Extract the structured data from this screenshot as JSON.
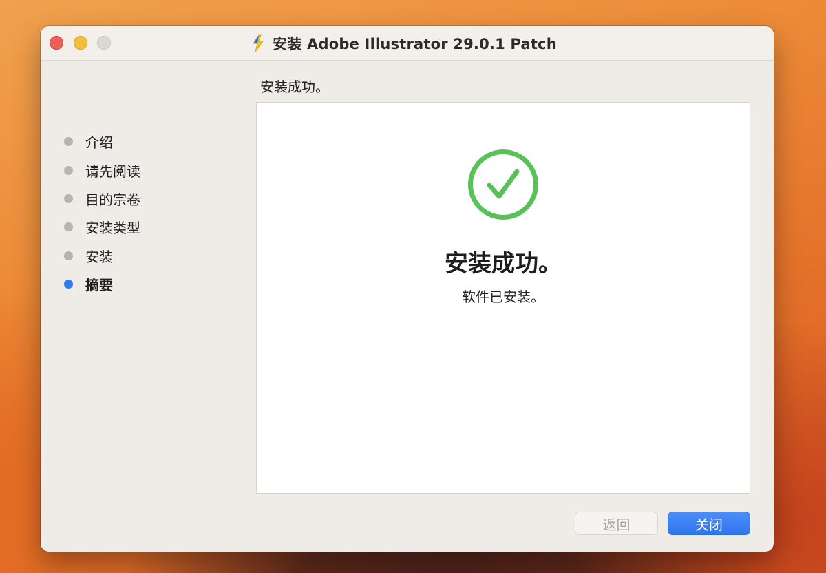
{
  "window": {
    "title": "安装 Adobe Illustrator 29.0.1 Patch",
    "app_icon": "installer-icon"
  },
  "sidebar": {
    "steps": [
      {
        "label": "介绍",
        "active": false
      },
      {
        "label": "请先阅读",
        "active": false
      },
      {
        "label": "目的宗卷",
        "active": false
      },
      {
        "label": "安装类型",
        "active": false
      },
      {
        "label": "安装",
        "active": false
      },
      {
        "label": "摘要",
        "active": true
      }
    ]
  },
  "main": {
    "header": "安装成功。",
    "status_icon": "checkmark-circle-icon",
    "success_title": "安装成功。",
    "success_message": "软件已安装。"
  },
  "buttons": {
    "back_label": "返回",
    "close_label": "关闭"
  },
  "colors": {
    "accent": "#2f7cf0",
    "success": "#5ac05a",
    "close_traffic": "#ec5f57",
    "minimize_traffic": "#f4bd3c"
  }
}
